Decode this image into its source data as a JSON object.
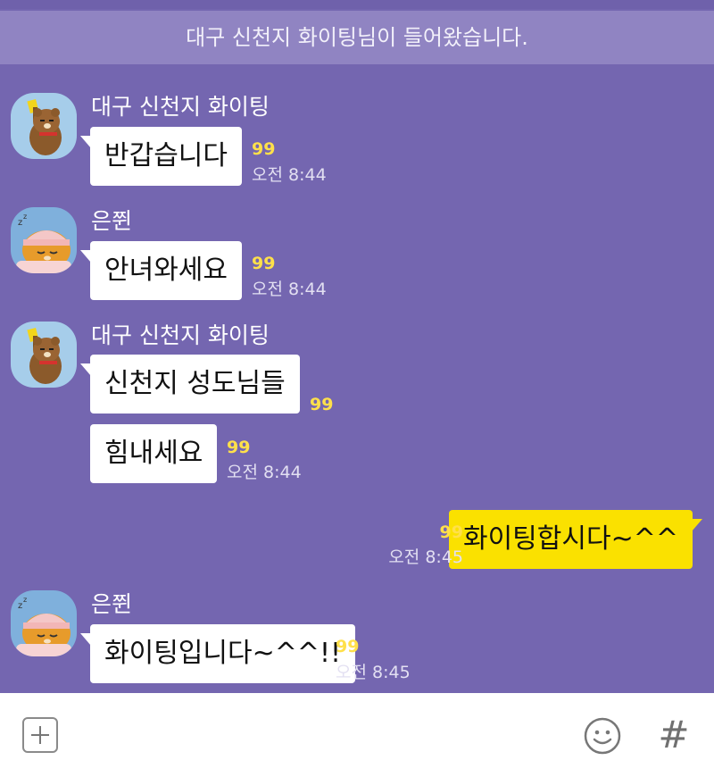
{
  "notice": "대구 신천지 화이팅님이 들어왔습니다.",
  "messages": [
    {
      "sender": "대구 신천지 화이팅",
      "text": "반갑습니다",
      "unread": "99",
      "time": "오전 8:44"
    },
    {
      "sender": "은쮠",
      "text": "안녀와세요",
      "unread": "99",
      "time": "오전 8:44"
    },
    {
      "sender": "대구 신천지 화이팅",
      "text": "신천지 성도님들",
      "unread": "99"
    },
    {
      "text": "힘내세요",
      "unread": "99",
      "time": "오전 8:44"
    },
    {
      "text": "화이팅합시다~^^",
      "unread": "99",
      "time": "오전 8:45",
      "mine": true
    },
    {
      "sender": "은쮠",
      "text": "화이팅입니다~^^!!",
      "unread": "99",
      "time": "오전 8:45"
    }
  ],
  "input": {
    "plus_icon": "plus-icon",
    "emoji_icon": "smiley-icon",
    "hash_label": "#"
  },
  "colors": {
    "background": "#7466b0",
    "notice_bg": "#9084c2",
    "my_bubble": "#fae100",
    "unread": "#ffe04a"
  }
}
